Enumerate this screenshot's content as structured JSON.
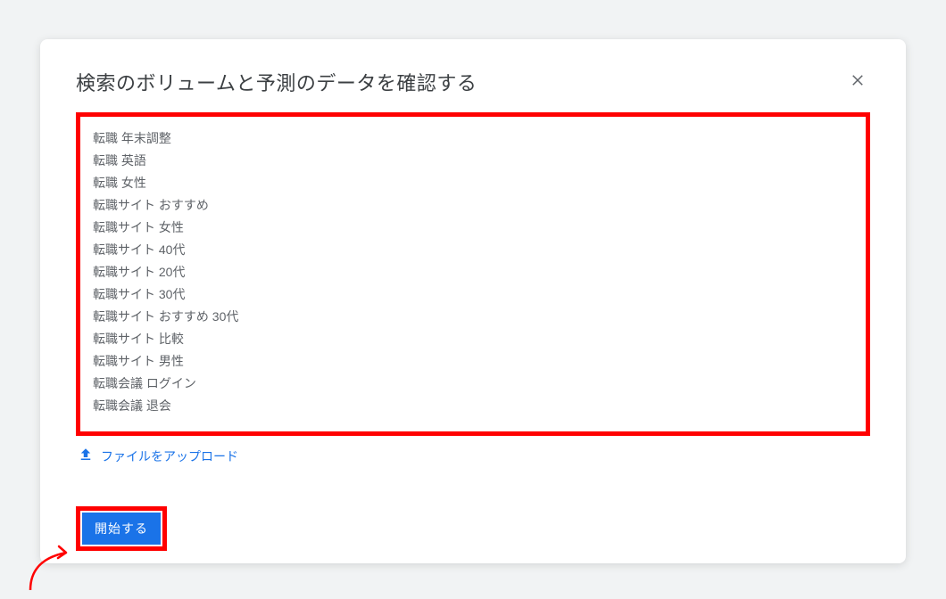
{
  "dialog": {
    "title": "検索のボリュームと予測のデータを確認する",
    "keywords_text": "転職 年末調整\n転職 英語\n転職 女性\n転職サイト おすすめ\n転職サイト 女性\n転職サイト 40代\n転職サイト 20代\n転職サイト 30代\n転職サイト おすすめ 30代\n転職サイト 比較\n転職サイト 男性\n転職会議 ログイン\n転職会議 退会",
    "upload_label": "ファイルをアップロード",
    "start_label": "開始する"
  },
  "annotation": {
    "highlight_color": "#ff0000",
    "arrow_color": "#ff0000"
  }
}
